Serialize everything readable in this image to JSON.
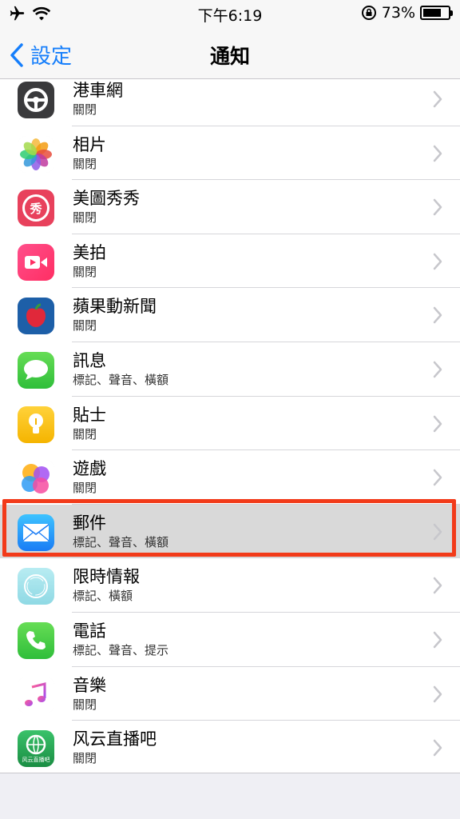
{
  "status_bar": {
    "time": "下午6:19",
    "battery_percent": "73%",
    "battery_level": 0.73
  },
  "nav": {
    "back_label": "設定",
    "title": "通知"
  },
  "apps": [
    {
      "name": "港車網",
      "status": "關閉",
      "icon": "steering-wheel-icon"
    },
    {
      "name": "相片",
      "status": "關閉",
      "icon": "photos-icon"
    },
    {
      "name": "美圖秀秀",
      "status": "關閉",
      "icon": "meitu-icon"
    },
    {
      "name": "美拍",
      "status": "關閉",
      "icon": "meipai-icon"
    },
    {
      "name": "蘋果動新聞",
      "status": "關閉",
      "icon": "apple-news-icon"
    },
    {
      "name": "訊息",
      "status": "標記、聲音、橫額",
      "icon": "messages-icon"
    },
    {
      "name": "貼士",
      "status": "關閉",
      "icon": "tips-icon"
    },
    {
      "name": "遊戲",
      "status": "關閉",
      "icon": "game-center-icon"
    },
    {
      "name": "郵件",
      "status": "標記、聲音、橫額",
      "icon": "mail-icon",
      "selected": true
    },
    {
      "name": "限時情報",
      "status": "標記、橫額",
      "icon": "ring-icon"
    },
    {
      "name": "電話",
      "status": "標記、聲音、提示",
      "icon": "phone-icon"
    },
    {
      "name": "音樂",
      "status": "關閉",
      "icon": "music-icon"
    },
    {
      "name": "风云直播吧",
      "status": "關閉",
      "icon": "fengyun-live-icon",
      "icon_label": "风云直播吧"
    }
  ],
  "colors": {
    "accent": "#157efb",
    "highlight_border": "#f23b1a"
  }
}
